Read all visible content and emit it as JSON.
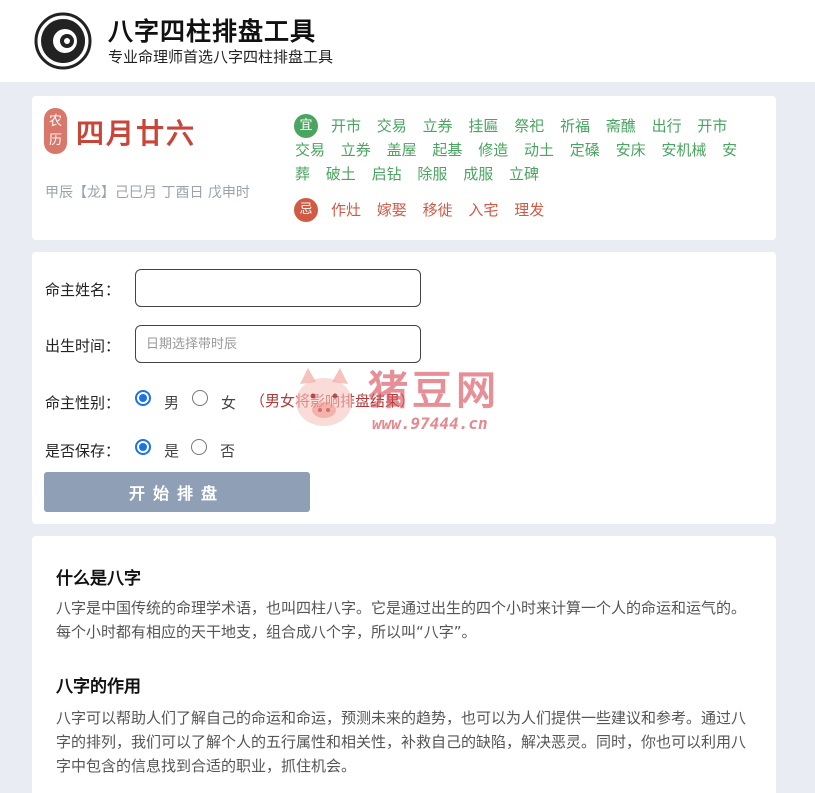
{
  "header": {
    "title": "八字四柱排盘工具",
    "subtitle": "专业命理师首选八字四柱排盘工具"
  },
  "calendar": {
    "lunar_badge": "农历",
    "lunar_date": "四月廿六",
    "ganzhi": "甲辰【龙】己巳月 丁酉日 戊申时",
    "yi_label": "宜",
    "yi_items": [
      "开市",
      "交易",
      "立券",
      "挂匾",
      "祭祀",
      "祈福",
      "斋醮",
      "出行",
      "开市",
      "交易",
      "立券",
      "盖屋",
      "起基",
      "修造",
      "动土",
      "定磉",
      "安床",
      "安机械",
      "安葬",
      "破土",
      "启钻",
      "除服",
      "成服",
      "立碑"
    ],
    "ji_label": "忌",
    "ji_items": [
      "作灶",
      "嫁娶",
      "移徙",
      "入宅",
      "理发"
    ]
  },
  "form": {
    "name_label": "命主姓名：",
    "name_value": "",
    "birth_label": "出生时间：",
    "birth_placeholder": "日期选择带时辰",
    "gender_label": "命主性别：",
    "gender_male": "男",
    "gender_female": "女",
    "gender_selected": "男",
    "gender_note": "（男女将影响排盘结果）",
    "save_label": "是否保存：",
    "save_yes": "是",
    "save_no": "否",
    "save_selected": "是",
    "start_button": "开始排盘"
  },
  "watermark": {
    "title": "猪豆网",
    "url": "www.97444.cn"
  },
  "info": {
    "section1_heading": "什么是八字",
    "section1_text": "八字是中国传统的命理学术语，也叫四柱八字。它是通过出生的四个小时来计算一个人的命运和运气的。每个小时都有相应的天干地支，组合成八个字，所以叫“八字”。",
    "section2_heading": "八字的作用",
    "section2_text": "八字可以帮助人们了解自己的命运和命运，预测未来的趋势，也可以为人们提供一些建议和参考。通过八字的排列，我们可以了解个人的五行属性和相关性，补救自己的缺陷，解决恶灵。同时，你也可以利用八字中包含的信息找到合适的职业，抓住机会。"
  },
  "colors": {
    "accent_red": "#c8453a",
    "yi_green": "#4aa560",
    "ji_red": "#d15a45",
    "button_bg": "#8fa0b6",
    "radio_blue": "#1a73e8",
    "page_bg": "#e9edf3"
  }
}
